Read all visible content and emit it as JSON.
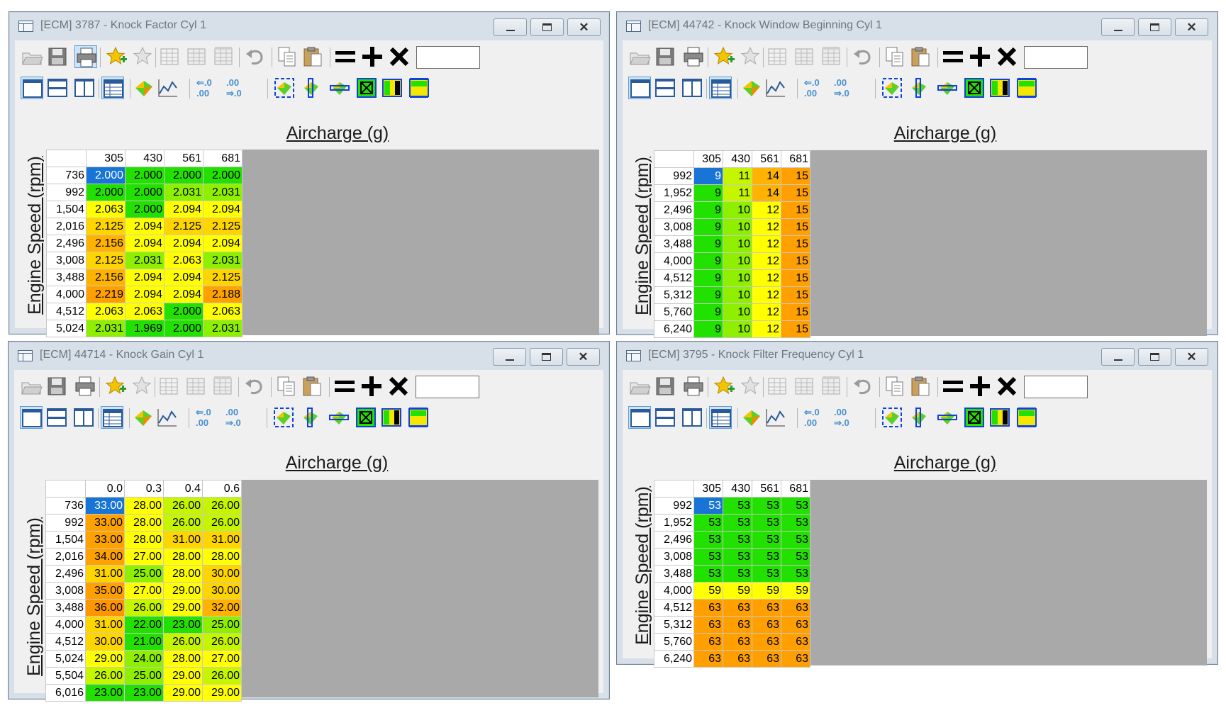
{
  "windows": [
    {
      "id": "w1",
      "title": "[ECM] 3787 - Knock Factor Cyl 1",
      "x_axis_label": "Aircharge (g)",
      "y_axis_label": "Engine Speed (rpm)",
      "columns": [
        "305",
        "430",
        "561",
        "681"
      ],
      "rows": [
        {
          "rpm": "736",
          "values": [
            "2.000",
            "2.000",
            "2.000",
            "2.000"
          ]
        },
        {
          "rpm": "992",
          "values": [
            "2.000",
            "2.000",
            "2.031",
            "2.031"
          ]
        },
        {
          "rpm": "1,504",
          "values": [
            "2.063",
            "2.000",
            "2.094",
            "2.094"
          ]
        },
        {
          "rpm": "2,016",
          "values": [
            "2.125",
            "2.094",
            "2.125",
            "2.125"
          ]
        },
        {
          "rpm": "2,496",
          "values": [
            "2.156",
            "2.094",
            "2.094",
            "2.094"
          ]
        },
        {
          "rpm": "3,008",
          "values": [
            "2.125",
            "2.031",
            "2.063",
            "2.031"
          ]
        },
        {
          "rpm": "3,488",
          "values": [
            "2.156",
            "2.094",
            "2.094",
            "2.125"
          ]
        },
        {
          "rpm": "4,000",
          "values": [
            "2.219",
            "2.094",
            "2.094",
            "2.188"
          ]
        },
        {
          "rpm": "4,512",
          "values": [
            "2.063",
            "2.063",
            "2.000",
            "2.063"
          ]
        },
        {
          "rpm": "5,024",
          "values": [
            "2.031",
            "1.969",
            "2.000",
            "2.031"
          ]
        }
      ],
      "cell_colors": [
        [
          "#1874d5",
          "#22e000",
          "#22e000",
          "#22e000"
        ],
        [
          "#22e000",
          "#22e000",
          "#8ef000",
          "#8ef000"
        ],
        [
          "#ffff00",
          "#22e000",
          "#ffff00",
          "#ffff00"
        ],
        [
          "#ffd500",
          "#ffff00",
          "#ffd500",
          "#ffd500"
        ],
        [
          "#ffb300",
          "#ffff00",
          "#ffff00",
          "#ffff00"
        ],
        [
          "#ffd500",
          "#8ef000",
          "#ffff00",
          "#8ef000"
        ],
        [
          "#ffb300",
          "#ffff00",
          "#ffff00",
          "#ffd500"
        ],
        [
          "#ff9f00",
          "#ffff00",
          "#ffff00",
          "#ffa200"
        ],
        [
          "#ffff00",
          "#ffff00",
          "#22e000",
          "#ffff00"
        ],
        [
          "#8ef000",
          "#22e000",
          "#22e000",
          "#8ef000"
        ]
      ]
    },
    {
      "id": "w2",
      "title": "[ECM] 44742 - Knock Window Beginning Cyl 1",
      "x_axis_label": "Aircharge (g)",
      "y_axis_label": "Engine Speed (rpm)",
      "columns": [
        "305",
        "430",
        "561",
        "681"
      ],
      "rows": [
        {
          "rpm": "992",
          "values": [
            "9",
            "11",
            "14",
            "15"
          ]
        },
        {
          "rpm": "1,952",
          "values": [
            "9",
            "11",
            "14",
            "15"
          ]
        },
        {
          "rpm": "2,496",
          "values": [
            "9",
            "10",
            "12",
            "15"
          ]
        },
        {
          "rpm": "3,008",
          "values": [
            "9",
            "10",
            "12",
            "15"
          ]
        },
        {
          "rpm": "3,488",
          "values": [
            "9",
            "10",
            "12",
            "15"
          ]
        },
        {
          "rpm": "4,000",
          "values": [
            "9",
            "10",
            "12",
            "15"
          ]
        },
        {
          "rpm": "4,512",
          "values": [
            "9",
            "10",
            "12",
            "15"
          ]
        },
        {
          "rpm": "5,312",
          "values": [
            "9",
            "10",
            "12",
            "15"
          ]
        },
        {
          "rpm": "5,760",
          "values": [
            "9",
            "10",
            "12",
            "15"
          ]
        },
        {
          "rpm": "6,240",
          "values": [
            "9",
            "10",
            "12",
            "15"
          ]
        }
      ],
      "cell_colors": [
        [
          "#1874d5",
          "#c6f500",
          "#ffb300",
          "#ff9f00"
        ],
        [
          "#22e000",
          "#c6f500",
          "#ffb300",
          "#ff9f00"
        ],
        [
          "#22e000",
          "#8ef000",
          "#ffff00",
          "#ff9f00"
        ],
        [
          "#22e000",
          "#8ef000",
          "#ffff00",
          "#ff9f00"
        ],
        [
          "#22e000",
          "#8ef000",
          "#ffff00",
          "#ff9f00"
        ],
        [
          "#22e000",
          "#8ef000",
          "#ffff00",
          "#ff9f00"
        ],
        [
          "#22e000",
          "#8ef000",
          "#ffff00",
          "#ff9f00"
        ],
        [
          "#22e000",
          "#8ef000",
          "#ffff00",
          "#ff9f00"
        ],
        [
          "#22e000",
          "#8ef000",
          "#ffff00",
          "#ff9f00"
        ],
        [
          "#22e000",
          "#8ef000",
          "#ffff00",
          "#ff9f00"
        ]
      ]
    },
    {
      "id": "w3",
      "title": "[ECM] 44714 - Knock Gain Cyl 1",
      "x_axis_label": "Aircharge (g)",
      "y_axis_label": "Engine Speed (rpm)",
      "columns": [
        "0.0",
        "0.3",
        "0.4",
        "0.6"
      ],
      "rows": [
        {
          "rpm": "736",
          "values": [
            "33.00",
            "28.00",
            "26.00",
            "26.00"
          ]
        },
        {
          "rpm": "992",
          "values": [
            "33.00",
            "28.00",
            "26.00",
            "26.00"
          ]
        },
        {
          "rpm": "1,504",
          "values": [
            "33.00",
            "28.00",
            "31.00",
            "31.00"
          ]
        },
        {
          "rpm": "2,016",
          "values": [
            "34.00",
            "27.00",
            "28.00",
            "28.00"
          ]
        },
        {
          "rpm": "2,496",
          "values": [
            "31.00",
            "25.00",
            "28.00",
            "30.00"
          ]
        },
        {
          "rpm": "3,008",
          "values": [
            "35.00",
            "27.00",
            "29.00",
            "30.00"
          ]
        },
        {
          "rpm": "3,488",
          "values": [
            "36.00",
            "26.00",
            "29.00",
            "32.00"
          ]
        },
        {
          "rpm": "4,000",
          "values": [
            "31.00",
            "22.00",
            "23.00",
            "25.00"
          ]
        },
        {
          "rpm": "4,512",
          "values": [
            "30.00",
            "21.00",
            "26.00",
            "26.00"
          ]
        },
        {
          "rpm": "5,024",
          "values": [
            "29.00",
            "24.00",
            "28.00",
            "27.00"
          ]
        },
        {
          "rpm": "5,504",
          "values": [
            "26.00",
            "25.00",
            "29.00",
            "26.00"
          ]
        },
        {
          "rpm": "6,016",
          "values": [
            "23.00",
            "23.00",
            "29.00",
            "29.00"
          ]
        }
      ],
      "cell_colors": [
        [
          "#1874d5",
          "#ffff00",
          "#c6f500",
          "#c6f500"
        ],
        [
          "#ffa200",
          "#ffff00",
          "#c6f500",
          "#c6f500"
        ],
        [
          "#ffa200",
          "#ffff00",
          "#ffd500",
          "#ffd500"
        ],
        [
          "#ffa200",
          "#ffff00",
          "#ffff00",
          "#ffff00"
        ],
        [
          "#ffd500",
          "#8ef000",
          "#ffff00",
          "#ffd500"
        ],
        [
          "#ff9f00",
          "#ffff00",
          "#ffff00",
          "#ffd500"
        ],
        [
          "#ff9600",
          "#c6f500",
          "#ffff00",
          "#ffb300"
        ],
        [
          "#ffd500",
          "#22e000",
          "#22e000",
          "#8ef000"
        ],
        [
          "#ffd500",
          "#22e000",
          "#c6f500",
          "#c6f500"
        ],
        [
          "#ffff00",
          "#8ef000",
          "#ffff00",
          "#ffff00"
        ],
        [
          "#c6f500",
          "#8ef000",
          "#ffff00",
          "#c6f500"
        ],
        [
          "#22e000",
          "#22e000",
          "#ffff00",
          "#ffff00"
        ]
      ]
    },
    {
      "id": "w4",
      "title": "[ECM] 3795 - Knock Filter Frequency Cyl 1",
      "x_axis_label": "Aircharge (g)",
      "y_axis_label": "Engine Speed (rpm)",
      "columns": [
        "305",
        "430",
        "561",
        "681"
      ],
      "rows": [
        {
          "rpm": "992",
          "values": [
            "53",
            "53",
            "53",
            "53"
          ]
        },
        {
          "rpm": "1,952",
          "values": [
            "53",
            "53",
            "53",
            "53"
          ]
        },
        {
          "rpm": "2,496",
          "values": [
            "53",
            "53",
            "53",
            "53"
          ]
        },
        {
          "rpm": "3,008",
          "values": [
            "53",
            "53",
            "53",
            "53"
          ]
        },
        {
          "rpm": "3,488",
          "values": [
            "53",
            "53",
            "53",
            "53"
          ]
        },
        {
          "rpm": "4,000",
          "values": [
            "59",
            "59",
            "59",
            "59"
          ]
        },
        {
          "rpm": "4,512",
          "values": [
            "63",
            "63",
            "63",
            "63"
          ]
        },
        {
          "rpm": "5,312",
          "values": [
            "63",
            "63",
            "63",
            "63"
          ]
        },
        {
          "rpm": "5,760",
          "values": [
            "63",
            "63",
            "63",
            "63"
          ]
        },
        {
          "rpm": "6,240",
          "values": [
            "63",
            "63",
            "63",
            "63"
          ]
        }
      ],
      "cell_colors": [
        [
          "#1874d5",
          "#22e000",
          "#22e000",
          "#22e000"
        ],
        [
          "#22e000",
          "#22e000",
          "#22e000",
          "#22e000"
        ],
        [
          "#22e000",
          "#22e000",
          "#22e000",
          "#22e000"
        ],
        [
          "#22e000",
          "#22e000",
          "#22e000",
          "#22e000"
        ],
        [
          "#22e000",
          "#22e000",
          "#22e000",
          "#22e000"
        ],
        [
          "#ffff00",
          "#ffff00",
          "#ffff00",
          "#ffff00"
        ],
        [
          "#ff9f00",
          "#ff9f00",
          "#ff9f00",
          "#ff9f00"
        ],
        [
          "#ff9f00",
          "#ff9f00",
          "#ff9f00",
          "#ff9f00"
        ],
        [
          "#ff9f00",
          "#ff9f00",
          "#ff9f00",
          "#ff9f00"
        ],
        [
          "#ff9f00",
          "#ff9f00",
          "#ff9f00",
          "#ff9f00"
        ]
      ]
    }
  ],
  "toolbar_icons": [
    "open-folder-icon",
    "save-icon",
    "print-icon",
    "add-favorite-icon",
    "favorite-icon",
    "table-icon",
    "table-copy-icon",
    "table-compare-icon",
    "undo-icon",
    "copy-icon",
    "paste-icon",
    "set-equal-icon",
    "add-icon",
    "multiply-icon"
  ],
  "view_icons": [
    "single-view-icon",
    "horizontal-split-icon",
    "vertical-split-icon",
    "table-view-icon",
    "3d-surface-icon",
    "2d-graph-icon",
    "decrease-decimals-icon",
    "increase-decimals-icon",
    "select-all-icon",
    "select-column-icon",
    "select-row-icon",
    "select-cell-icon",
    "fill-vertical-icon",
    "fill-horizontal-icon"
  ]
}
